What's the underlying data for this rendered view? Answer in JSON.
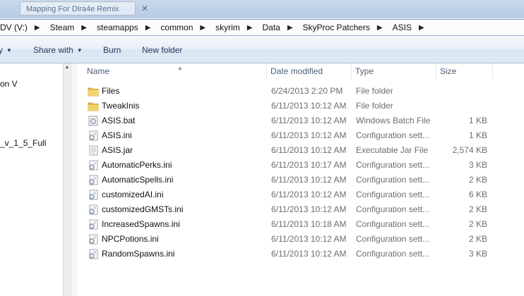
{
  "window": {
    "tab_title": "Mapping For Dlra4e Remix"
  },
  "addressbar": {
    "crumbs": [
      "DV (V:)",
      "Steam",
      "steamapps",
      "common",
      "skyrim",
      "Data",
      "SkyProc Patchers",
      "ASIS"
    ]
  },
  "commandbar": {
    "organize_fragment": "y",
    "share_with": "Share with",
    "burn": "Burn",
    "new_folder": "New folder"
  },
  "navpane": {
    "items": [
      "on V",
      "_v_1_5_Full"
    ]
  },
  "columns": {
    "name": "Name",
    "date_modified": "Date modified",
    "type": "Type",
    "size": "Size"
  },
  "files": [
    {
      "icon": "folder-icon",
      "name": "Files",
      "date": "6/24/2013 2:20 PM",
      "type": "File folder",
      "size": ""
    },
    {
      "icon": "folder-icon",
      "name": "TweakInis",
      "date": "6/11/2013 10:12 AM",
      "type": "File folder",
      "size": ""
    },
    {
      "icon": "batch-file-icon",
      "name": "ASIS.bat",
      "date": "6/11/2013 10:12 AM",
      "type": "Windows Batch File",
      "size": "1 KB"
    },
    {
      "icon": "config-file-icon",
      "name": "ASIS.ini",
      "date": "6/11/2013 10:12 AM",
      "type": "Configuration sett...",
      "size": "1 KB"
    },
    {
      "icon": "jar-file-icon",
      "name": "ASIS.jar",
      "date": "6/11/2013 10:12 AM",
      "type": "Executable Jar File",
      "size": "2,574 KB"
    },
    {
      "icon": "config-file-icon",
      "name": "AutomaticPerks.ini",
      "date": "6/11/2013 10:17 AM",
      "type": "Configuration sett...",
      "size": "3 KB"
    },
    {
      "icon": "config-file-icon",
      "name": "AutomaticSpells.ini",
      "date": "6/11/2013 10:12 AM",
      "type": "Configuration sett...",
      "size": "2 KB"
    },
    {
      "icon": "config-file-icon",
      "name": "customizedAI.ini",
      "date": "6/11/2013 10:12 AM",
      "type": "Configuration sett...",
      "size": "6 KB"
    },
    {
      "icon": "config-file-icon",
      "name": "customizedGMSTs.ini",
      "date": "6/11/2013 10:12 AM",
      "type": "Configuration sett...",
      "size": "2 KB"
    },
    {
      "icon": "config-file-icon",
      "name": "IncreasedSpawns.ini",
      "date": "6/11/2013 10:18 AM",
      "type": "Configuration sett...",
      "size": "2 KB"
    },
    {
      "icon": "config-file-icon",
      "name": "NPCPotions.ini",
      "date": "6/11/2013 10:12 AM",
      "type": "Configuration sett...",
      "size": "2 KB"
    },
    {
      "icon": "config-file-icon",
      "name": "RandomSpawns.ini",
      "date": "6/11/2013 10:12 AM",
      "type": "Configuration sett...",
      "size": "3 KB"
    }
  ],
  "colors": {
    "folder": "#e8c04a",
    "secondary_text": "#6d6d6d",
    "command_text": "#1e395b",
    "header_text": "#4c607a"
  }
}
